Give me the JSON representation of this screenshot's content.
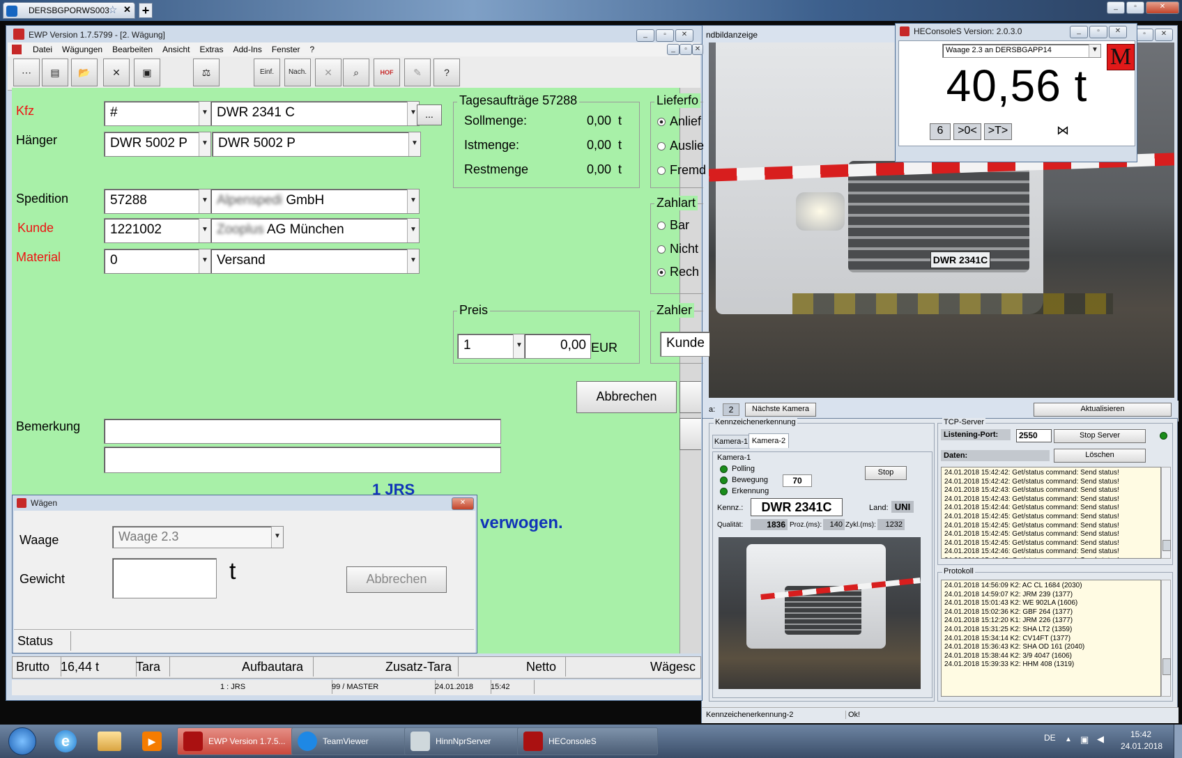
{
  "browser": {
    "tab_title": "DERSBGPORWS003",
    "new_tab_symbol": "+"
  },
  "camera_view": {
    "title_fragment": "ndbildanzeige",
    "camera_number_label_fragment": "a:",
    "camera_number": "2",
    "next_camera_button": "Nächste Kamera",
    "refresh_button": "Aktualisieren",
    "plate_text": "DWR 2341C"
  },
  "ewp": {
    "title": "EWP Version 1.7.5799 - [2. Wägung]",
    "menu": [
      "Datei",
      "Wägungen",
      "Bearbeiten",
      "Ansicht",
      "Extras",
      "Add-Ins",
      "Fenster",
      "?"
    ],
    "toolbar": {
      "einfahrt": "Einf.",
      "nachwiegen": "Nach.",
      "hof": "HOF"
    },
    "form": {
      "kfz_label": "Kfz",
      "kfz_code": "#",
      "kfz_value": "DWR 2341 C",
      "ellipsis": "...",
      "haenger_label": "Hänger",
      "haenger_code": "DWR 5002 P",
      "haenger_value": "DWR 5002 P",
      "spedition_label": "Spedition",
      "spedition_code": "57288",
      "spedition_name_blurred": "Alpenspedi",
      "spedition_name": "GmbH",
      "kunde_label": "Kunde",
      "kunde_code": "1221002",
      "kunde_name_blurred": "Zooplus",
      "kunde_name": "AG München",
      "material_label": "Material",
      "material_code": "0",
      "material_value": "Versand",
      "bemerkung_label": "Bemerkung",
      "partial_line": "1 JRS",
      "weighed_text": "verwogen."
    },
    "tagesauftraege": {
      "title": "Tagesaufträge 57288",
      "rows": [
        {
          "label": "Sollmenge:",
          "value": "0,00",
          "unit": "t"
        },
        {
          "label": "Istmenge:",
          "value": "0,00",
          "unit": "t"
        },
        {
          "label": "Restmenge",
          "value": "0,00",
          "unit": "t"
        }
      ]
    },
    "lieferform": {
      "title": "Lieferfo",
      "options": [
        "Anlief",
        "Auslie",
        "Fremd"
      ],
      "selected": 0
    },
    "zahlart": {
      "title": "Zahlart",
      "options": [
        "Bar",
        "Nicht",
        "Rech"
      ],
      "selected": 2
    },
    "preis": {
      "title": "Preis",
      "qty": "1",
      "price": "0,00",
      "currency": "EUR"
    },
    "zahler": {
      "title": "Zahler",
      "value": "Kunde"
    },
    "abbrechen_button": "Abbrechen",
    "bottom_bar": [
      {
        "label": "Brutto",
        "value": "16,44 t"
      },
      {
        "label": "Tara",
        "value": ""
      },
      {
        "label": "Aufbautara",
        "value": ""
      },
      {
        "label": "Zusatz-Tara",
        "value": ""
      },
      {
        "label": "Netto",
        "value": ""
      },
      {
        "label": "Wägesc",
        "value": ""
      }
    ],
    "status_bar": [
      "",
      "",
      "",
      "1 : JRS",
      "99 / MASTER",
      "24.01.2018",
      "15:42",
      ""
    ]
  },
  "waegen_dialog": {
    "title": "Wägen",
    "waage_label": "Waage",
    "waage_value": "Waage 2.3",
    "gewicht_label": "Gewicht",
    "gewicht_unit": "t",
    "abbrechen_button": "Abbrechen",
    "status_label": "Status"
  },
  "heconsole": {
    "title": "HEConsoleS Version: 2.0.3.0",
    "scale_select": "Waage 2.3 an DERSBGAPP14",
    "weight": "40,56 t",
    "logo_letter": "M",
    "buttons": [
      "6",
      ">0<",
      ">T>"
    ]
  },
  "plate_recognition": {
    "group_title": "Kennzeichenerkennung",
    "tabs": [
      "Kamera-1",
      "Kamera-2"
    ],
    "camera_group": "Kamera-1",
    "polling": "Polling",
    "bewegung": "Bewegung",
    "bewegung_value": "70",
    "erkennung": "Erkennung",
    "stop_button": "Stop",
    "kennz_label": "Kennz.:",
    "kennz_value": "DWR 2341C",
    "land_label": "Land:",
    "land_value": "UNI",
    "qualitaet_label": "Qualität:",
    "qualitaet_value": "1836",
    "proz_label": "Proz.(ms):",
    "proz_value": "140",
    "zykl_label": "Zykl.(ms):",
    "zykl_value": "1232",
    "status_left": "Kennzeichenerkennung-2",
    "status_right": "Ok!"
  },
  "tcp_server": {
    "group_title": "TCP-Server",
    "port_label": "Listening-Port:",
    "port_value": "2550",
    "stop_server_button": "Stop Server",
    "daten_label": "Daten:",
    "loeschen_button": "Löschen",
    "log": [
      "24.01.2018 15:42:42:  Get/status command: Send status!",
      "24.01.2018 15:42:42:  Get/status command: Send status!",
      "24.01.2018 15:42:43:  Get/status command: Send status!",
      "24.01.2018 15:42:43:  Get/status command: Send status!",
      "24.01.2018 15:42:44:  Get/status command: Send status!",
      "24.01.2018 15:42:45:  Get/status command: Send status!",
      "24.01.2018 15:42:45:  Get/status command: Send status!",
      "24.01.2018 15:42:45:  Get/status command: Send status!",
      "24.01.2018 15:42:45:  Get/status command: Send status!",
      "24.01.2018 15:42:46:  Get/status command: Send status!",
      "24.01.2018 15:42:46:  Get/status command: Send status!"
    ]
  },
  "protokoll": {
    "group_title": "Protokoll",
    "log": [
      "24.01.2018 14:56:09  K2:  AC CL 1684 (2030)",
      "24.01.2018 14:59:07  K2:  JRM 239 (1377)",
      "24.01.2018 15:01:43  K2:  WE 902LA (1606)",
      "24.01.2018 15:02:36  K2:  GBF 264 (1377)",
      "24.01.2018 15:12:20  K1:  JRM 226 (1377)",
      "24.01.2018 15:31:25  K2:  SHA LT2 (1359)",
      "24.01.2018 15:34:14  K2:  CV14FT (1377)",
      "24.01.2018 15:36:43  K2:  SHA OD 161 (2040)",
      "24.01.2018 15:38:44  K2:  3/9 4047 (1606)",
      "24.01.2018 15:39:33  K2:  HHM 408 (1319)"
    ]
  },
  "taskbar": {
    "items": [
      "EWP Version 1.7.5...",
      "TeamViewer",
      "HinnNprServer",
      "HEConsoleS"
    ],
    "lang": "DE",
    "time": "15:42",
    "date": "24.01.2018"
  },
  "colors": {
    "form_bg": "#a8f0a8",
    "label_red": "#e11111",
    "weighed_blue": "#1033b8",
    "log_bg": "#fffbe3"
  }
}
